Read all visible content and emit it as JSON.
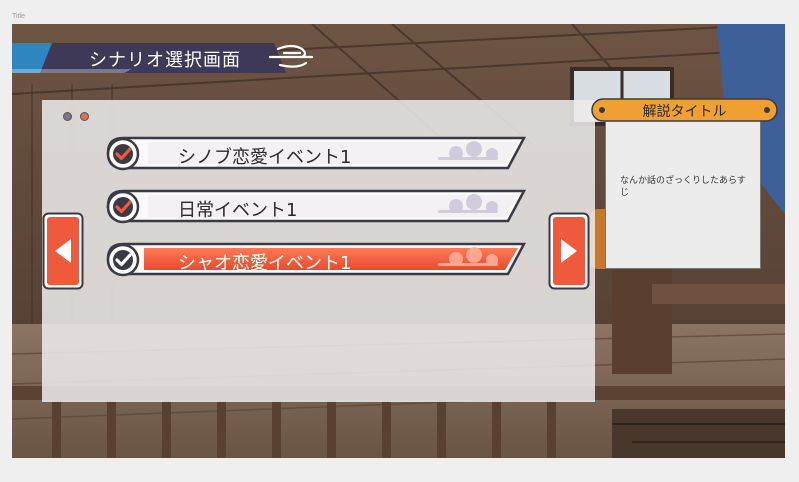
{
  "window": {
    "title": "Title"
  },
  "header": {
    "title": "シナリオ選択画面"
  },
  "scenario_list": {
    "items": [
      {
        "label": "シノブ恋愛イベント1",
        "selected": false
      },
      {
        "label": "日常イベント1",
        "selected": false
      },
      {
        "label": "シャオ恋愛イベント1",
        "selected": true
      }
    ]
  },
  "description": {
    "title": "解説タイトル",
    "body": "なんか話のざっくりしたあらすじ"
  },
  "colors": {
    "accent": "#f05a3c",
    "banner_blue": "#2e86c1",
    "banner_dark": "#3e3956",
    "header_orange": "#f0a030"
  }
}
